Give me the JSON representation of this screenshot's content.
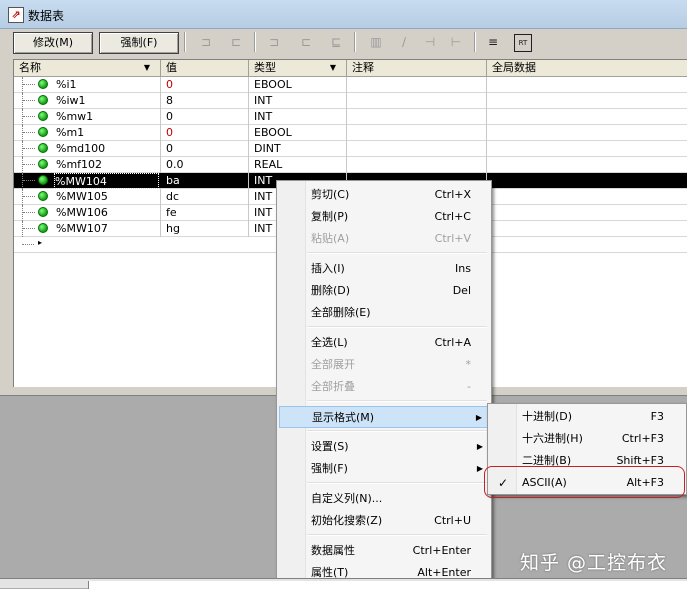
{
  "window": {
    "title": "数据表"
  },
  "toolbar": {
    "modify_label": "修改(M)",
    "force_label": "强制(F)",
    "icons": [
      "force-edge-icon",
      "force-rising-icon",
      "edge-icon",
      "rising-icon",
      "falling-icon",
      "table-icon",
      "pencil-icon",
      "h-icon",
      "ht-icon",
      "sort-icon",
      "rt-icon"
    ]
  },
  "table": {
    "headers": [
      "名称",
      "值",
      "类型",
      "注释",
      "全局数据"
    ],
    "rows": [
      {
        "name": "%i1",
        "value": "0",
        "type": "EBOOL",
        "value_red": true
      },
      {
        "name": "%iw1",
        "value": "8",
        "type": "INT",
        "value_red": false
      },
      {
        "name": "%mw1",
        "value": "0",
        "type": "INT",
        "value_red": false
      },
      {
        "name": "%m1",
        "value": "0",
        "type": "EBOOL",
        "value_red": true
      },
      {
        "name": "%md100",
        "value": "0",
        "type": "DINT",
        "value_red": false
      },
      {
        "name": "%mf102",
        "value": "0.0",
        "type": "REAL",
        "value_red": false
      },
      {
        "name": "%MW104",
        "value": "ba",
        "type": "INT",
        "value_red": false,
        "selected": true
      },
      {
        "name": "%MW105",
        "value": "dc",
        "type": "INT",
        "value_red": false
      },
      {
        "name": "%MW106",
        "value": "fe",
        "type": "INT",
        "value_red": false
      },
      {
        "name": "%MW107",
        "value": "hg",
        "type": "INT",
        "value_red": false
      }
    ]
  },
  "context_menu": {
    "items": [
      {
        "label": "剪切(C)",
        "shortcut": "Ctrl+X",
        "disabled": false
      },
      {
        "label": "复制(P)",
        "shortcut": "Ctrl+C",
        "disabled": false
      },
      {
        "label": "粘贴(A)",
        "shortcut": "Ctrl+V",
        "disabled": true
      },
      {
        "label": "插入(I)",
        "shortcut": "Ins",
        "disabled": false
      },
      {
        "label": "删除(D)",
        "shortcut": "Del",
        "disabled": false
      },
      {
        "label": "全部删除(E)",
        "shortcut": "",
        "disabled": false
      },
      {
        "label": "全选(L)",
        "shortcut": "Ctrl+A",
        "disabled": false
      },
      {
        "label": "全部展开",
        "shortcut": "*",
        "disabled": true
      },
      {
        "label": "全部折叠",
        "shortcut": "-",
        "disabled": true
      },
      {
        "label": "显示格式(M)",
        "shortcut": "",
        "disabled": false,
        "submenu": true,
        "highlighted": true
      },
      {
        "label": "设置(S)",
        "shortcut": "",
        "disabled": false,
        "submenu": true
      },
      {
        "label": "强制(F)",
        "shortcut": "",
        "disabled": false,
        "submenu": true
      },
      {
        "label": "自定义列(N)...",
        "shortcut": "",
        "disabled": false
      },
      {
        "label": "初始化搜索(Z)",
        "shortcut": "Ctrl+U",
        "disabled": false
      },
      {
        "label": "数据属性",
        "shortcut": "Ctrl+Enter",
        "disabled": false
      },
      {
        "label": "属性(T)",
        "shortcut": "Alt+Enter",
        "disabled": false
      }
    ]
  },
  "format_submenu": {
    "items": [
      {
        "label": "十进制(D)",
        "shortcut": "F3",
        "checked": false
      },
      {
        "label": "十六进制(H)",
        "shortcut": "Ctrl+F3",
        "checked": false
      },
      {
        "label": "二进制(B)",
        "shortcut": "Shift+F3",
        "checked": false
      },
      {
        "label": "ASCII(A)",
        "shortcut": "Alt+F3",
        "checked": true
      }
    ],
    "check_glyph": "✓"
  },
  "watermark": "知乎 @工控布衣",
  "colors": {
    "selected_row": "#000000",
    "red_value": "#c00000",
    "status_green": "#10a010",
    "highlight_oval": "#c82020"
  }
}
